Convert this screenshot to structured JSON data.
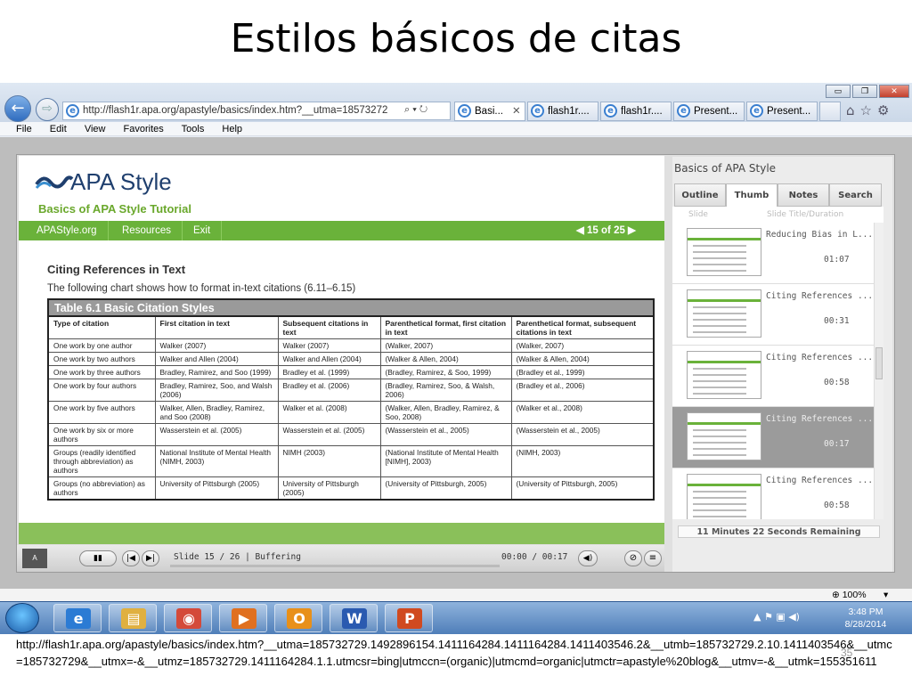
{
  "slide": {
    "title": "Estilos básicos de citas",
    "page_number": "35"
  },
  "browser": {
    "back": "←",
    "forward": "⇨",
    "address": "http://flash1r.apa.org/apastyle/basics/index.htm?__utma=18573272",
    "address_controls": "⌕ ▾ ↻",
    "tabs": [
      {
        "label": "Basi...",
        "close": "✕",
        "active": true
      },
      {
        "label": "flash1r...."
      },
      {
        "label": "flash1r...."
      },
      {
        "label": "Present..."
      },
      {
        "label": "Present..."
      }
    ],
    "toolbar_icons": [
      "⌂",
      "☆",
      "⚙"
    ],
    "window_controls": [
      "▭",
      "❐",
      "✕"
    ],
    "menu": [
      "File",
      "Edit",
      "View",
      "Favorites",
      "Tools",
      "Help"
    ],
    "zoom": "100%",
    "zoom_arrow": "▾"
  },
  "presentation": {
    "logo": "APA Style",
    "logo_sub": "Basics of APA Style Tutorial",
    "nav_items": [
      "APAStyle.org",
      "Resources",
      "Exit"
    ],
    "counter": "◀  15 of 25  ▶",
    "heading": "Citing References in Text",
    "intro": "The following chart shows how to format in-text citations (6.11–6.15)",
    "table_caption": "Table 6.1 Basic Citation Styles",
    "table_headers": [
      "Type of citation",
      "First citation in text",
      "Subsequent citations in text",
      "Parenthetical format, first citation in text",
      "Parenthetical format, subsequent citations in text"
    ],
    "table_rows": [
      [
        "One work by one author",
        "Walker (2007)",
        "Walker (2007)",
        "(Walker, 2007)",
        "(Walker, 2007)"
      ],
      [
        "One work by two authors",
        "Walker and Allen (2004)",
        "Walker and Allen (2004)",
        "(Walker & Allen, 2004)",
        "(Walker & Allen, 2004)"
      ],
      [
        "One work by three authors",
        "Bradley, Ramirez, and Soo (1999)",
        "Bradley et al. (1999)",
        "(Bradley, Ramirez, & Soo, 1999)",
        "(Bradley et al., 1999)"
      ],
      [
        "One work by four authors",
        "Bradley, Ramirez, Soo, and Walsh (2006)",
        "Bradley et al. (2006)",
        "(Bradley, Ramirez, Soo, & Walsh, 2006)",
        "(Bradley et al., 2006)"
      ],
      [
        "One work by five authors",
        "Walker, Allen, Bradley, Ramirez, and Soo (2008)",
        "Walker et al. (2008)",
        "(Walker, Allen, Bradley, Ramirez, & Soo, 2008)",
        "(Walker et al., 2008)"
      ],
      [
        "One work by six or more authors",
        "Wasserstein et al. (2005)",
        "Wasserstein et al. (2005)",
        "(Wasserstein et al., 2005)",
        "(Wasserstein et al., 2005)"
      ],
      [
        "Groups (readily identified through abbreviation) as authors",
        "National Institute of Mental Health (NIMH, 2003)",
        "NIMH (2003)",
        "(National Institute of Mental Health [NIMH], 2003)",
        "(NIMH, 2003)"
      ],
      [
        "Groups (no abbreviation) as authors",
        "University of Pittsburgh (2005)",
        "University of Pittsburgh (2005)",
        "(University of Pittsburgh, 2005)",
        "(University of Pittsburgh, 2005)"
      ]
    ],
    "player_status": "Slide 15 / 26 | Buffering",
    "player_time": "00:00 / 00:17",
    "play_icon": "▮▮",
    "prev_icon": "|◀",
    "next_icon": "▶|",
    "volume_icon": "◀)",
    "sidebar_title": "Basics of APA Style",
    "sidebar_tabs": [
      "Outline",
      "Thumb",
      "Notes",
      "Search"
    ],
    "sidebar_col_slide": "Slide",
    "sidebar_col_title": "Slide Title/Duration",
    "thumbs": [
      {
        "title": "Reducing Bias in L...",
        "duration": "01:07"
      },
      {
        "title": "Citing References ...",
        "duration": "00:31"
      },
      {
        "title": "Citing References ...",
        "duration": "00:58"
      },
      {
        "title": "Citing References ...",
        "duration": "00:17"
      },
      {
        "title": "Citing References ...",
        "duration": "00:58"
      }
    ],
    "remaining": "11 Minutes 22 Seconds Remaining"
  },
  "taskbar": {
    "time": "3:48 PM",
    "date": "8/28/2014",
    "apps": [
      {
        "name": "ie",
        "glyph": "e",
        "color": "#2b7bd4"
      },
      {
        "name": "explorer",
        "glyph": "▤",
        "color": "#e0b040"
      },
      {
        "name": "chrome",
        "glyph": "◉",
        "color": "#d44a3a"
      },
      {
        "name": "media",
        "glyph": "▶",
        "color": "#e07020"
      },
      {
        "name": "outlook",
        "glyph": "O",
        "color": "#e8901a"
      },
      {
        "name": "word",
        "glyph": "W",
        "color": "#2a5ab0"
      },
      {
        "name": "powerpoint",
        "glyph": "P",
        "color": "#d04a20"
      }
    ]
  },
  "footer_url": "http://flash1r.apa.org/apastyle/basics/index.htm?__utma=185732729.1492896154.1411164284.1411164284.1411403546.2&__utmb=185732729.2.10.1411403546&__utmc=185732729&__utmx=-&__utmz=185732729.1411164284.1.1.utmcsr=bing|utmccn=(organic)|utmcmd=organic|utmctr=apastyle%20blog&__utmv=-&__utmk=155351611"
}
